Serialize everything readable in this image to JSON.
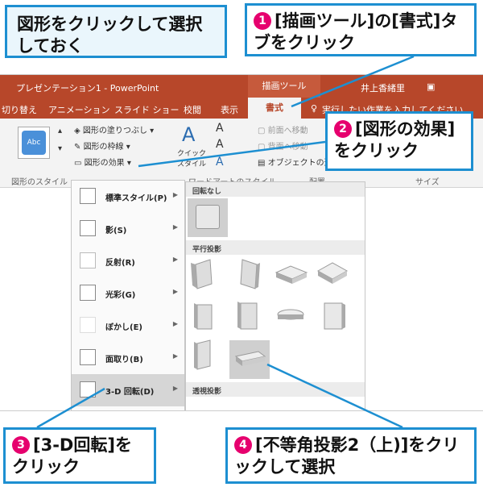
{
  "callouts": {
    "heading": "図形をクリックして選択しておく",
    "step1": {
      "num": "1",
      "text": "[描画ツール]の[書式]タブをクリック"
    },
    "step2": {
      "num": "2",
      "text": "[図形の効果]をクリック"
    },
    "step3": {
      "num": "3",
      "text": "[3-D回転]をクリック"
    },
    "step4": {
      "num": "4",
      "text": "[不等角投影2（上)]をクリックして選択"
    }
  },
  "titlebar": {
    "title": "プレゼンテーション1 - PowerPoint",
    "context_tab": "描画ツール",
    "user": "井上香緒里"
  },
  "tabs": [
    "切り替え",
    "アニメーション",
    "スライド ショー",
    "校閲",
    "表示"
  ],
  "active_tab": "書式",
  "tell_me": "実行したい作業を入力してください",
  "ribbon": {
    "abc_label": "Abc",
    "fill": "図形の塗りつぶし",
    "outline": "図形の枠線",
    "effects": "図形の効果",
    "quick_style": "クイック スタイル",
    "bring_forward": "前面へ移動",
    "send_backward": "背面へ移動",
    "selection_pane": "オブジェクトの選択",
    "group_shape_style": "図形のスタイル",
    "group_wordart": "ワードアートのスタイル",
    "group_arrange": "配置",
    "group_size": "サイズ"
  },
  "menu": [
    {
      "label": "標準スタイル(P)"
    },
    {
      "label": "影(S)"
    },
    {
      "label": "反射(R)"
    },
    {
      "label": "光彩(G)"
    },
    {
      "label": "ぼかし(E)"
    },
    {
      "label": "面取り(B)"
    },
    {
      "label": "3-D 回転(D)"
    }
  ],
  "gallery": {
    "no_rotation": "回転なし",
    "parallel": "平行投影",
    "perspective": "透視投影"
  },
  "colors": {
    "accent": "#b7472a",
    "callout_border": "#1d8fd1",
    "step_number": "#e6006e"
  }
}
